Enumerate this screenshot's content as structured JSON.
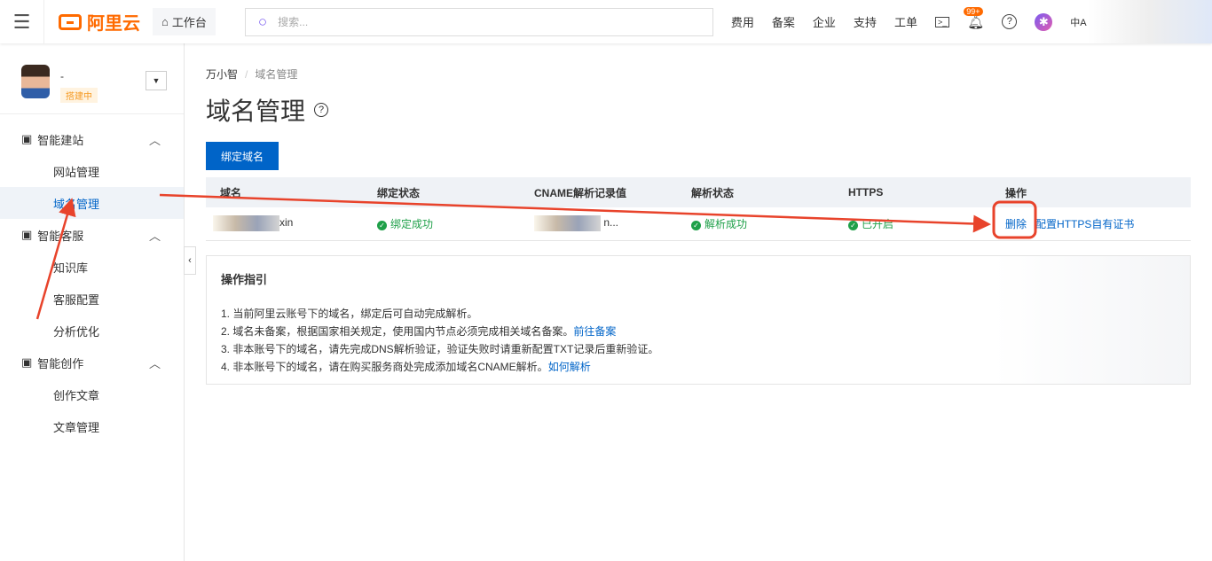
{
  "topbar": {
    "brand": "阿里云",
    "workbench": "工作台",
    "search_placeholder": "搜索...",
    "nav": [
      "费用",
      "备案",
      "企业",
      "支持",
      "工单"
    ],
    "notification_count": "99+"
  },
  "sidebar": {
    "user_name": "-",
    "user_status": "搭建中",
    "groups": [
      {
        "label": "智能建站",
        "items": [
          "网站管理",
          "域名管理"
        ]
      },
      {
        "label": "智能客服",
        "items": [
          "知识库",
          "客服配置",
          "分析优化"
        ]
      },
      {
        "label": "智能创作",
        "items": [
          "创作文章",
          "文章管理"
        ]
      }
    ]
  },
  "breadcrumb": [
    "万小智",
    "域名管理"
  ],
  "page_title": "域名管理",
  "bind_button": "绑定域名",
  "table": {
    "headers": [
      "域名",
      "绑定状态",
      "CNAME解析记录值",
      "解析状态",
      "HTTPS",
      "操作"
    ],
    "rows": [
      {
        "domain_suffix": "xin",
        "bind": "绑定成功",
        "cname_suffix": "n...",
        "resolve": "解析成功",
        "https": "已开启",
        "actions": [
          "删除",
          "配置HTTPS自有证书"
        ]
      }
    ]
  },
  "guide": {
    "title": "操作指引",
    "lines": [
      {
        "text": "1. 当前阿里云账号下的域名，绑定后可自动完成解析。"
      },
      {
        "text": "2. 域名未备案，根据国家相关规定，使用国内节点必须完成相关域名备案。",
        "link": "前往备案"
      },
      {
        "text": "3. 非本账号下的域名，请先完成DNS解析验证，验证失败时请重新配置TXT记录后重新验证。"
      },
      {
        "text": "4. 非本账号下的域名，请在购买服务商处完成添加域名CNAME解析。",
        "link": "如何解析"
      }
    ]
  },
  "colors": {
    "primary": "#0064c8",
    "brand": "#ff6a00",
    "success": "#1fa049",
    "annotation": "#e8432b"
  }
}
